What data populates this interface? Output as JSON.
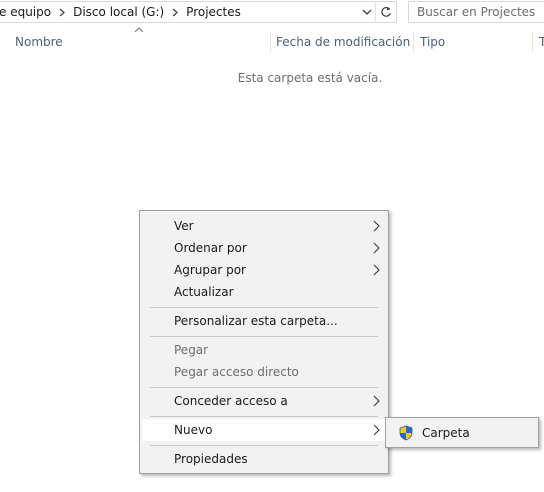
{
  "address_bar": {
    "crumbs": [
      "e equipo",
      "Disco local (G:)",
      "Projectes"
    ],
    "dropdown_icon": "chevron-down-icon",
    "refresh_icon": "refresh-icon"
  },
  "search": {
    "placeholder": "Buscar en Projectes"
  },
  "columns": {
    "name": "Nombre",
    "modified": "Fecha de modificación",
    "type": "Tipo",
    "size": "T"
  },
  "content": {
    "empty_message": "Esta carpeta está vacía."
  },
  "context_menu": {
    "view": "Ver",
    "sort_by": "Ordenar por",
    "group_by": "Agrupar por",
    "refresh": "Actualizar",
    "customize": "Personalizar esta carpeta...",
    "paste": "Pegar",
    "paste_shortcut": "Pegar acceso directo",
    "give_access": "Conceder acceso a",
    "new": "Nuevo",
    "properties": "Propiedades"
  },
  "submenu_new": {
    "folder": "Carpeta",
    "folder_icon": "uac-shield-icon"
  },
  "colors": {
    "menu_background": "#f2f2f2",
    "menu_highlight": "#ffffff",
    "header_text": "#4c607a",
    "disabled_text": "#6d6d6d",
    "shield_blue": "#2a6ac6",
    "shield_yellow": "#f4c430"
  }
}
